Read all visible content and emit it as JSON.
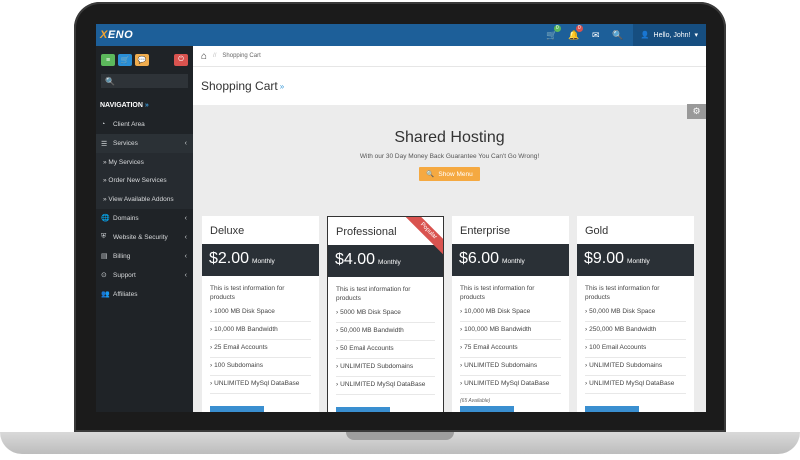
{
  "app": {
    "logo_mark": "X",
    "logo_text": "ENO"
  },
  "topbar": {
    "cart_badge": "0",
    "notif_badge": "0",
    "user_label": "Hello, John!"
  },
  "sidebar": {
    "search_placeholder": "",
    "nav_title": "NAVIGATION",
    "items": [
      {
        "label": "Client Area",
        "icon": "dashboard-icon"
      },
      {
        "label": "Services",
        "icon": "list-icon"
      },
      {
        "label": "» My Services"
      },
      {
        "label": "» Order New Services"
      },
      {
        "label": "» View Available Addons"
      },
      {
        "label": "Domains",
        "icon": "globe-icon"
      },
      {
        "label": "Website & Security",
        "icon": "shield-icon"
      },
      {
        "label": "Billing",
        "icon": "billing-icon"
      },
      {
        "label": "Support",
        "icon": "support-icon"
      },
      {
        "label": "Affiliates",
        "icon": "affiliates-icon"
      }
    ]
  },
  "breadcrumb": {
    "current": "Shopping Cart"
  },
  "page": {
    "title": "Shopping Cart",
    "hero_title": "Shared Hosting",
    "hero_subtitle": "With our 30 Day Money Back Guarantee You Can't Go Wrong!",
    "show_menu": "Show Menu"
  },
  "plans": [
    {
      "name": "Deluxe",
      "price": "$2.00",
      "period": "Monthly",
      "desc": "This is test information for products",
      "features": [
        "1000 MB Disk Space",
        "10,000 MB Bandwidth",
        "25 Email Accounts",
        "100 Subdomains",
        "UNLIMITED MySql DataBase"
      ],
      "availability": ""
    },
    {
      "name": "Professional",
      "price": "$4.00",
      "period": "Monthly",
      "desc": "This is test information for products",
      "features": [
        "5000 MB Disk Space",
        "50,000 MB Bandwidth",
        "50 Email Accounts",
        "UNLIMITED Subdomains",
        "UNLIMITED MySql DataBase"
      ],
      "availability": "",
      "ribbon": "Popular"
    },
    {
      "name": "Enterprise",
      "price": "$6.00",
      "period": "Monthly",
      "desc": "This is test information for products",
      "features": [
        "10,000 MB Disk Space",
        "100,000 MB Bandwidth",
        "75 Email Accounts",
        "UNLIMITED Subdomains",
        "UNLIMITED MySql DataBase"
      ],
      "availability": "(65 Available)"
    },
    {
      "name": "Gold",
      "price": "$9.00",
      "period": "Monthly",
      "desc": "This is test information for products",
      "features": [
        "50,000 MB Disk Space",
        "250,000 MB Bandwidth",
        "100 Email Accounts",
        "UNLIMITED Subdomains",
        "UNLIMITED MySql DataBase"
      ],
      "availability": ""
    }
  ],
  "colors": {
    "topbar": "#1d5f99",
    "sidebar": "#1f2327",
    "accent_orange": "#f5a941",
    "price_band": "#2a3036",
    "ribbon": "#d9534f",
    "order_button": "#3a8fd0"
  }
}
